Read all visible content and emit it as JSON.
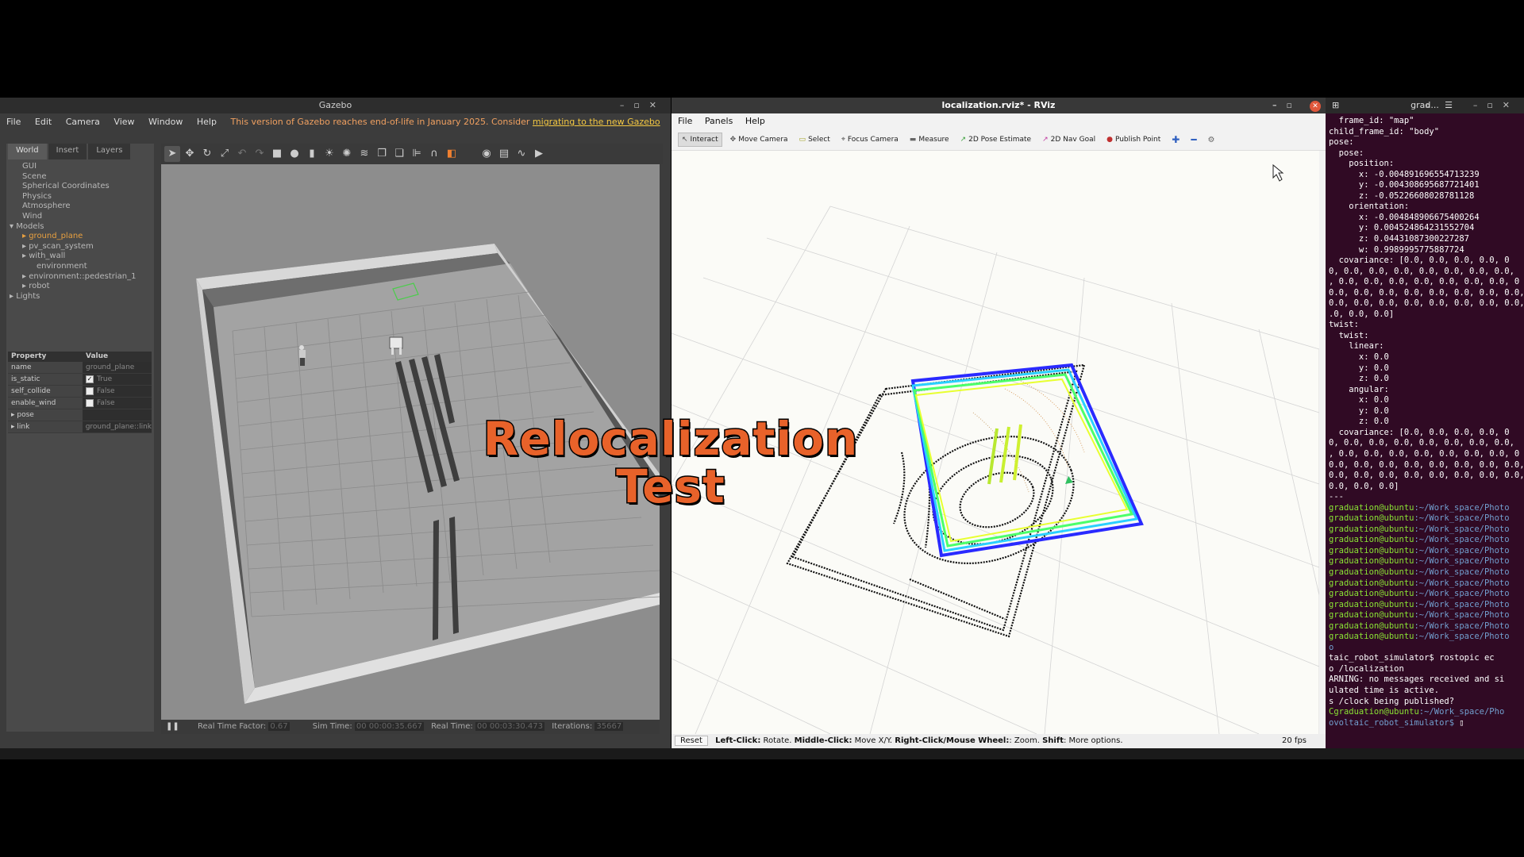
{
  "gazebo": {
    "title": "Gazebo",
    "menu": [
      "File",
      "Edit",
      "Camera",
      "View",
      "Window",
      "Help"
    ],
    "eol_notice": "This version of Gazebo reaches end-of-life in January 2025. Consider ",
    "eol_link": "migrating to the new Gazebo",
    "tabs": [
      "World",
      "Insert",
      "Layers"
    ],
    "tree": [
      "GUI",
      "Scene",
      "Spherical Coordinates",
      "Physics",
      "Atmosphere",
      "Wind",
      "Models",
      "ground_plane",
      "pv_scan_system",
      "with_wall",
      "environment",
      "environment::pedestrian_1",
      "robot",
      "Lights"
    ],
    "props_header": {
      "property": "Property",
      "value": "Value"
    },
    "props": [
      {
        "key": "name",
        "value": "ground_plane"
      },
      {
        "key": "is_static",
        "value": "True",
        "checked": "✓"
      },
      {
        "key": "self_collide",
        "value": "False"
      },
      {
        "key": "enable_wind",
        "value": "False"
      },
      {
        "key": "pose",
        "value": ""
      },
      {
        "key": "link",
        "value": "ground_plane::link"
      }
    ],
    "bottom": {
      "pause": "❚❚",
      "rtf_label": "Real Time Factor:",
      "rtf": "0.67",
      "sim_label": "Sim Time:",
      "sim": "00 00:00:35.667",
      "real_label": "Real Time:",
      "real": "00 00:03:30.473",
      "iter_label": "Iterations:",
      "iter": "35667"
    }
  },
  "rviz": {
    "title": "localization.rviz* - RViz",
    "menu": [
      "File",
      "Panels",
      "Help"
    ],
    "tools": [
      {
        "label": "Interact",
        "icon": "↖",
        "color": "#444"
      },
      {
        "label": "Move Camera",
        "icon": "✥",
        "color": "#555"
      },
      {
        "label": "Select",
        "icon": "▭",
        "color": "#a0a020"
      },
      {
        "label": "Focus Camera",
        "icon": "⌖",
        "color": "#555"
      },
      {
        "label": "Measure",
        "icon": "▬",
        "color": "#666"
      },
      {
        "label": "2D Pose Estimate",
        "icon": "↗",
        "color": "#3aa03a"
      },
      {
        "label": "2D Nav Goal",
        "icon": "↗",
        "color": "#c03aa0"
      },
      {
        "label": "Publish Point",
        "icon": "●",
        "color": "#c03030"
      }
    ],
    "status": {
      "reset": "Reset",
      "left": "Left-Click:",
      "left_d": " Rotate. ",
      "middle": "Middle-Click:",
      "middle_d": " Move X/Y. ",
      "right": "Right-Click/Mouse Wheel:",
      "right_d": ": Zoom. ",
      "shift": "Shift",
      "shift_d": ": More options.",
      "fps": "20 fps"
    }
  },
  "terminal": {
    "title": "grad...",
    "lines": [
      "  frame_id: \"map\"",
      "child_frame_id: \"body\"",
      "pose:",
      "  pose:",
      "    position:",
      "      x: -0.004891696554713239",
      "      y: -0.004308695687721401",
      "      z: -0.05226608028781128",
      "    orientation:",
      "      x: -0.004848906675400264",
      "      y: 0.004524864231552704",
      "      z: 0.04431087300227287",
      "      w: 0.9989995775887724",
      "  covariance: [0.0, 0.0, 0.0, 0.0, 0",
      "0, 0.0, 0.0, 0.0, 0.0, 0.0, 0.0, 0.0,",
      ", 0.0, 0.0, 0.0, 0.0, 0.0, 0.0, 0.0, 0",
      "0.0, 0.0, 0.0, 0.0, 0.0, 0.0, 0.0, 0.0,",
      "0.0, 0.0, 0.0, 0.0, 0.0, 0.0, 0.0, 0.0,",
      ".0, 0.0, 0.0]",
      "twist:",
      "  twist:",
      "    linear:",
      "      x: 0.0",
      "      y: 0.0",
      "      z: 0.0",
      "    angular:",
      "      x: 0.0",
      "      y: 0.0",
      "      z: 0.0",
      "  covariance: [0.0, 0.0, 0.0, 0.0, 0",
      "0, 0.0, 0.0, 0.0, 0.0, 0.0, 0.0, 0.0,",
      ", 0.0, 0.0, 0.0, 0.0, 0.0, 0.0, 0.0, 0",
      "0.0, 0.0, 0.0, 0.0, 0.0, 0.0, 0.0, 0.0,",
      "0.0, 0.0, 0.0, 0.0, 0.0, 0.0, 0.0, 0.0,",
      "0.0, 0.0, 0.0]",
      "---"
    ],
    "prompt_user": "graduation@ubuntu",
    "prompt_path": ":~/Work_space/Photo",
    "prompt_count": 13,
    "tail": [
      "o",
      "taic_robot_simulator$ rostopic ec",
      "o /localization",
      "ARNING: no messages received and si",
      "ulated time is active.",
      "s /clock being published?"
    ],
    "last_prompt_user": "Cgraduation@ubuntu",
    "last_prompt_path": ":~/Work_space/Pho",
    "last_line": "ovoltaic_robot_simulator$ "
  },
  "overlay": {
    "line1": "Relocalization",
    "line2": "Test"
  }
}
